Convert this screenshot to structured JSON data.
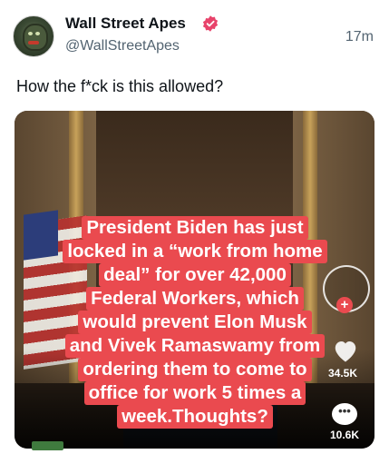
{
  "author": {
    "name": "Wall Street Apes",
    "handle": "@WallStreetApes",
    "time": "17m",
    "verified_color": "#e8436b"
  },
  "tweet": {
    "text": "How the f*ck is this allowed?"
  },
  "media": {
    "caption_lines": [
      "President Biden has just",
      "locked in a “work from home",
      "deal” for over 42,000",
      "Federal Workers, which",
      "would prevent Elon Musk",
      "and Vivek Ramaswamy from",
      "ordering them to come to",
      "office for work 5 times a",
      "week.Thoughts?"
    ],
    "caption_bg": "#ea4a4f",
    "likes": "34.5K",
    "comments": "10.6K",
    "follow_symbol": "+"
  },
  "icons": [
    "verified-badge-icon",
    "heart-icon",
    "comment-icon",
    "plus-icon"
  ]
}
